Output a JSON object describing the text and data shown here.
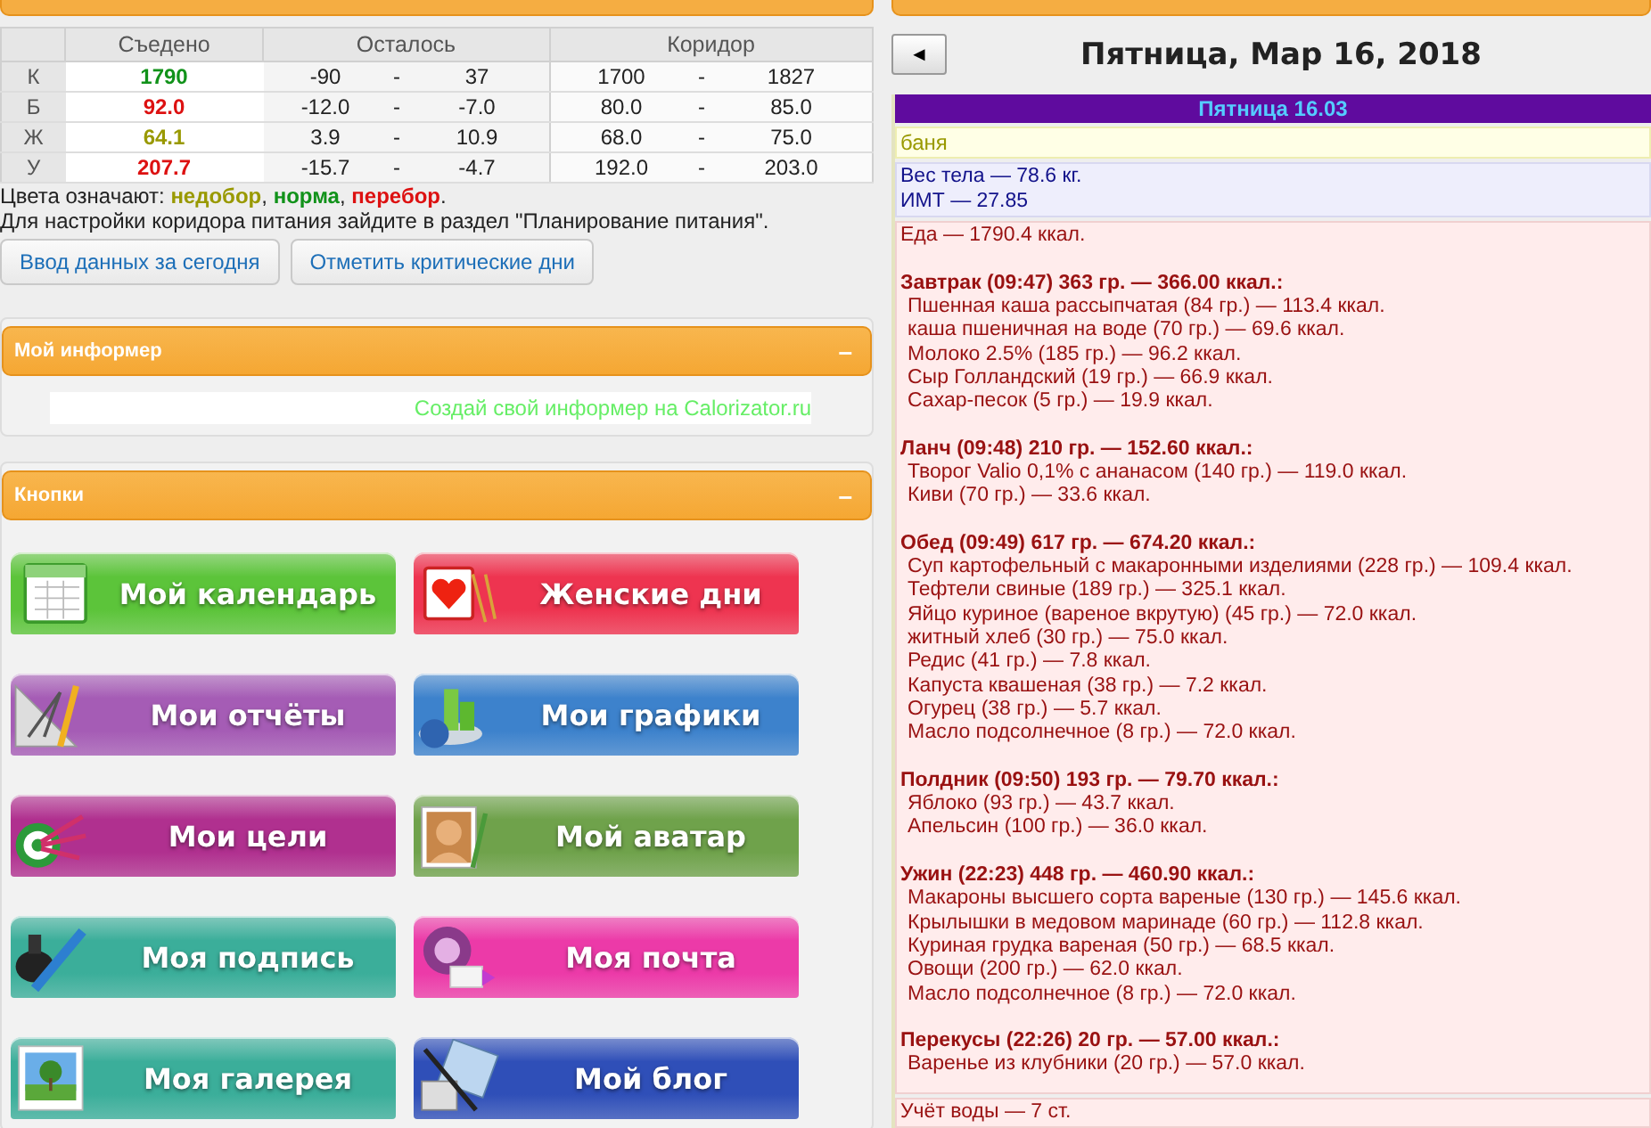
{
  "summary": {
    "columns": [
      "Съедено",
      "Осталось",
      "Коридор"
    ],
    "rows": [
      {
        "label": "К",
        "eaten": "1790",
        "color": "#11921a",
        "left_min": "-90",
        "left_max": "37",
        "corridor_min": "1700",
        "corridor_max": "1827"
      },
      {
        "label": "Б",
        "eaten": "92.0",
        "color": "#dd1111",
        "left_min": "-12.0",
        "left_max": "-7.0",
        "corridor_min": "80.0",
        "corridor_max": "85.0"
      },
      {
        "label": "Ж",
        "eaten": "64.1",
        "color": "#999900",
        "left_min": "3.9",
        "left_max": "10.9",
        "corridor_min": "68.0",
        "corridor_max": "75.0"
      },
      {
        "label": "У",
        "eaten": "207.7",
        "color": "#dd1111",
        "left_min": "-15.7",
        "left_max": "-4.7",
        "corridor_min": "192.0",
        "corridor_max": "203.0"
      }
    ],
    "separator": "-",
    "legend_intro": "Цвета означают:",
    "legend": [
      {
        "text": "недобор",
        "color": "#999900"
      },
      {
        "text": "норма",
        "color": "#11921a"
      },
      {
        "text": "перебор",
        "color": "#dd1111"
      }
    ],
    "legend_sep": ",",
    "legend_end": ".",
    "hint": "Для настройки коридора питания зайдите в раздел \"Планирование питания\".",
    "buttons": [
      "Ввод данных за сегодня",
      "Отметить критические дни"
    ]
  },
  "informer": {
    "title": "Мой информер",
    "collapse": "–",
    "link": "Создай свой информер на Calorizator.ru"
  },
  "buttons_panel": {
    "title": "Кнопки",
    "collapse": "–",
    "buttons": [
      {
        "label": "Мой календарь",
        "color": "#5cc43a",
        "kind": "calendar"
      },
      {
        "label": "Женские дни",
        "color": "#ee3450",
        "kind": "heart"
      },
      {
        "label": "Мои отчёты",
        "color": "#a55cb5",
        "kind": "tools"
      },
      {
        "label": "Мои графики",
        "color": "#3d82cc",
        "kind": "chart"
      },
      {
        "label": "Мои цели",
        "color": "#b0308f",
        "kind": "target"
      },
      {
        "label": "Мой аватар",
        "color": "#6fa24b",
        "kind": "portrait"
      },
      {
        "label": "Моя подпись",
        "color": "#3bae9a",
        "kind": "pen"
      },
      {
        "label": "Моя почта",
        "color": "#ec3aa8",
        "kind": "mail"
      },
      {
        "label": "Моя галерея",
        "color": "#3bae9a",
        "kind": "photo"
      },
      {
        "label": "Мой блог",
        "color": "#2f4fb8",
        "kind": "notepad"
      }
    ]
  },
  "diary": {
    "back": "◄",
    "title": "Пятница, Мар 16, 2018",
    "day": "Пятница 16.03",
    "note": "баня",
    "body": [
      "Вес тела — 78.6 кг.",
      "ИМТ — 27.85"
    ],
    "food_total": "Еда — 1790.4 ккал.",
    "meals": [
      {
        "title": "Завтрак (09:47) 363 гр. — 366.00 ккал.:",
        "items": [
          "Пшенная каша рассыпчатая (84 гр.) — 113.4 ккал.",
          "каша пшеничная на воде (70 гр.) — 69.6 ккал.",
          "Молоко 2.5% (185 гр.) — 96.2 ккал.",
          "Сыр Голландский (19 гр.) — 66.9 ккал.",
          "Сахар-песок (5 гр.) — 19.9 ккал."
        ]
      },
      {
        "title": "Ланч (09:48) 210 гр. — 152.60 ккал.:",
        "items": [
          "Творог Valio 0,1% с ананасом (140 гр.) — 119.0 ккал.",
          "Киви (70 гр.) — 33.6 ккал."
        ]
      },
      {
        "title": "Обед (09:49) 617 гр. — 674.20 ккал.:",
        "items": [
          "Суп картофельный с макаронными изделиями (228 гр.) — 109.4 ккал.",
          "Тефтели свиные (189 гр.) — 325.1 ккал.",
          "Яйцо куриное (вареное вкрутую) (45 гр.) — 72.0 ккал.",
          "житный хлеб (30 гр.) — 75.0 ккал.",
          "Редис (41 гр.) — 7.8 ккал.",
          "Капуста квашеная (38 гр.) — 7.2 ккал.",
          "Огурец (38 гр.) — 5.7 ккал.",
          "Масло подсолнечное (8 гр.) — 72.0 ккал."
        ]
      },
      {
        "title": "Полдник (09:50) 193 гр. — 79.70 ккал.:",
        "items": [
          "Яблоко (93 гр.) — 43.7 ккал.",
          "Апельсин (100 гр.) — 36.0 ккал."
        ]
      },
      {
        "title": "Ужин (22:23) 448 гр. — 460.90 ккал.:",
        "items": [
          "Макароны высшего сорта вареные (130 гр.) — 145.6 ккал.",
          "Крылышки в медовом маринаде (60 гр.) — 112.8 ккал.",
          "Куриная грудка вареная (50 гр.) — 68.5 ккал.",
          "Овощи (200 гр.) — 62.0 ккал.",
          "Масло подсолнечное (8 гр.) — 72.0 ккал."
        ]
      },
      {
        "title": "Перекусы (22:26) 20 гр. — 57.00 ккал.:",
        "items": [
          "Варенье из клубники (20 гр.) — 57.0 ккал."
        ]
      }
    ],
    "water": "Учёт воды — 7 ст."
  }
}
